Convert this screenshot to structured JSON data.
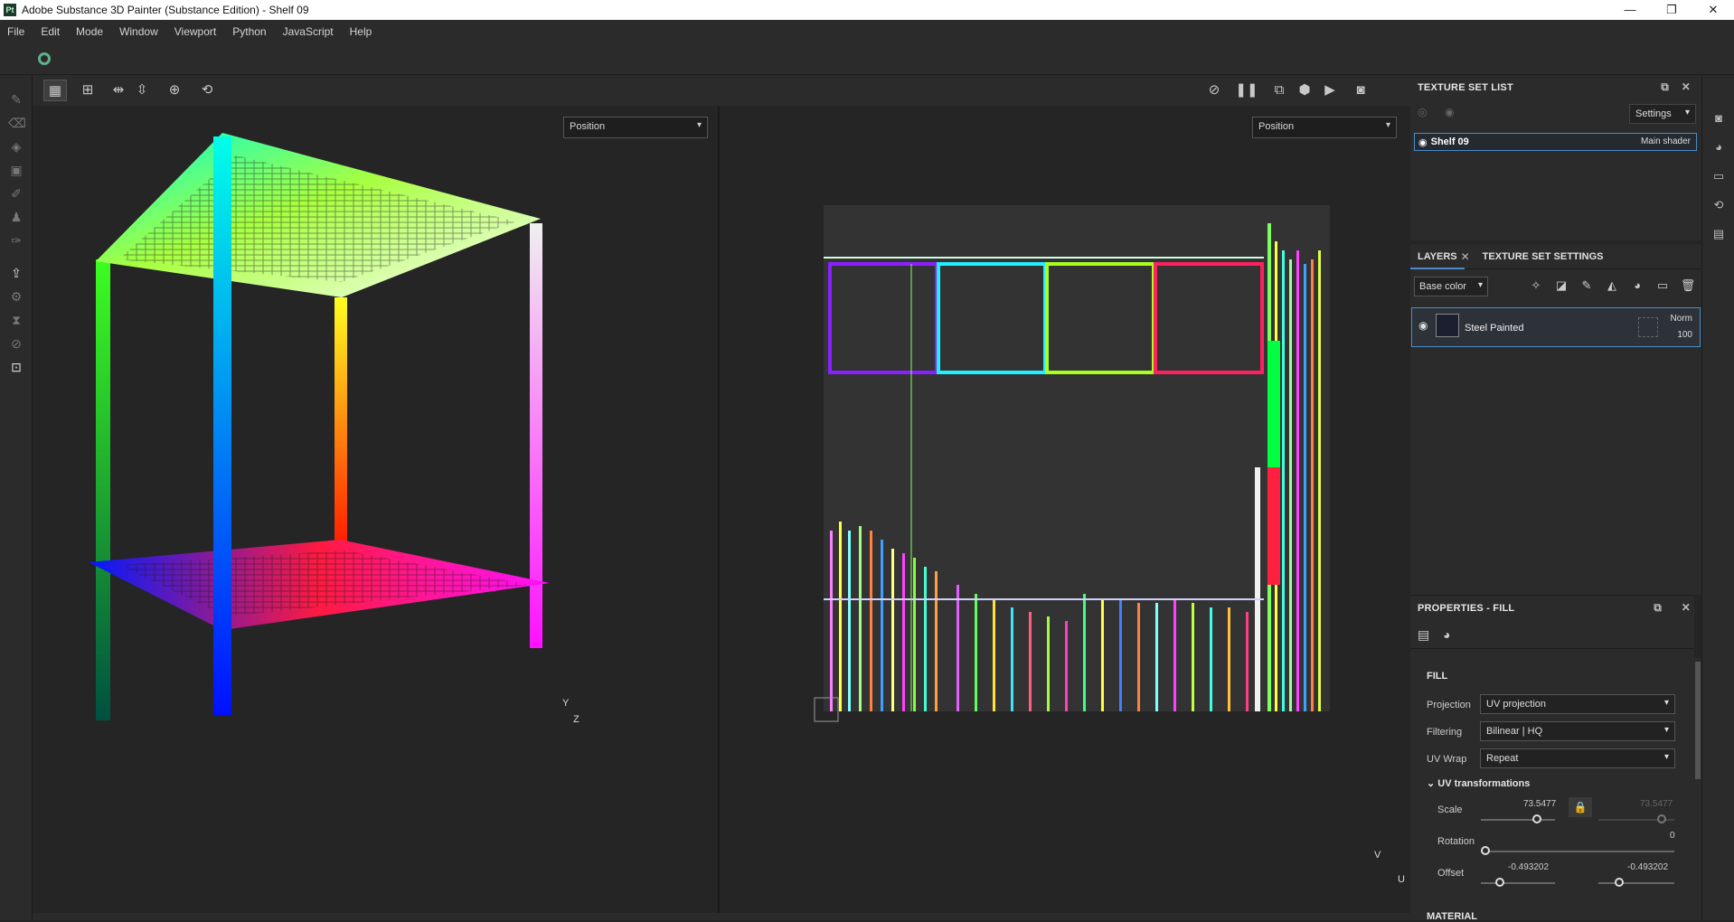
{
  "window": {
    "title": "Adobe Substance 3D Painter (Substance Edition) - Shelf 09",
    "app_logo": "Pt",
    "controls": [
      "—",
      "❐",
      "✕"
    ]
  },
  "menu": [
    "File",
    "Edit",
    "Mode",
    "Window",
    "Viewport",
    "Python",
    "JavaScript",
    "Help"
  ],
  "viewport3d": {
    "channel": "Position",
    "axis_y": "Y",
    "axis_z": "Z"
  },
  "viewport2d": {
    "channel": "Position",
    "axis_v": "V",
    "axis_u": "U"
  },
  "texture_set_list": {
    "title": "TEXTURE SET LIST",
    "settings_label": "Settings",
    "items": [
      {
        "name": "Shelf 09",
        "shader": "Main shader"
      }
    ]
  },
  "layers": {
    "tab_layers": "LAYERS",
    "tab_tss": "TEXTURE SET SETTINGS",
    "channel": "Base color",
    "items": [
      {
        "name": "Steel Painted",
        "blend": "Norm",
        "opacity": "100"
      }
    ]
  },
  "properties": {
    "title": "PROPERTIES - FILL",
    "section_fill": "FILL",
    "projection_label": "Projection",
    "projection_value": "UV projection",
    "filtering_label": "Filtering",
    "filtering_value": "Bilinear | HQ",
    "uvwrap_label": "UV Wrap",
    "uvwrap_value": "Repeat",
    "uv_transform_label": "UV transformations",
    "scale_label": "Scale",
    "scale_u": "73.5477",
    "scale_v": "73.5477",
    "rotation_label": "Rotation",
    "rotation_value": "0",
    "offset_label": "Offset",
    "offset_u": "-0.493202",
    "offset_v": "-0.493202",
    "material_label": "MATERIAL"
  }
}
